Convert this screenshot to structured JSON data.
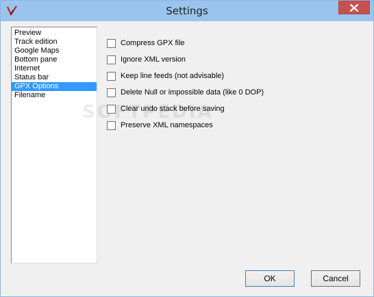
{
  "window": {
    "title": "Settings"
  },
  "nav": {
    "items": [
      {
        "label": "Preview",
        "selected": false
      },
      {
        "label": "Track edition",
        "selected": false
      },
      {
        "label": "Google Maps",
        "selected": false
      },
      {
        "label": "Bottom pane",
        "selected": false
      },
      {
        "label": "Internet",
        "selected": false
      },
      {
        "label": "Status bar",
        "selected": false
      },
      {
        "label": "GPX Options",
        "selected": true
      },
      {
        "label": "Filename",
        "selected": false
      }
    ]
  },
  "options": [
    {
      "label": "Compress GPX file",
      "checked": false
    },
    {
      "label": "Ignore XML version",
      "checked": false
    },
    {
      "label": "Keep line feeds (not advisable)",
      "checked": false
    },
    {
      "label": "Delete Null or impossible data (like 0 DOP)",
      "checked": false
    },
    {
      "label": "Clear undo stack before saving",
      "checked": false
    },
    {
      "label": "Preserve XML namespaces",
      "checked": false
    }
  ],
  "buttons": {
    "ok": "OK",
    "cancel": "Cancel"
  },
  "watermark": "SOFTPEDIA",
  "colors": {
    "titlebar": "#9ac4ee",
    "close": "#c75050",
    "selection": "#3399ff"
  },
  "icons": {
    "app": "gpx-app-icon",
    "close": "close-icon"
  }
}
